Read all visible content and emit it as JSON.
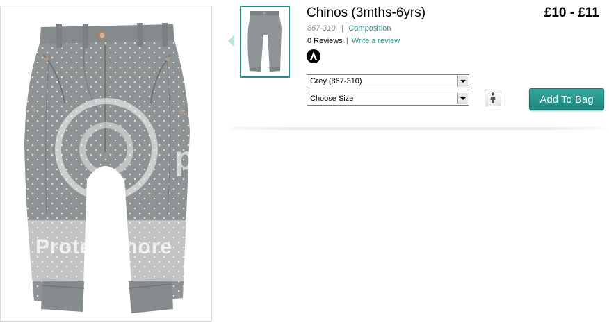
{
  "product": {
    "title": "Chinos (3mths-6yrs)",
    "price": "£10 - £11",
    "code": "867-310",
    "composition_link": "Composition",
    "reviews_count": "0 Reviews",
    "write_review_link": "Write a review",
    "separator": "|"
  },
  "options": {
    "colour_selected": "Grey (867-310)",
    "size_selected": "Choose Size"
  },
  "buttons": {
    "add_to_bag": "Add To Bag"
  },
  "watermark": {
    "text": "Protect more",
    "letter": "p"
  },
  "colors": {
    "accent": "#2a8f87",
    "button": "#289890",
    "chino_grey": "#8e9396"
  },
  "icons": {
    "thumbnail_prev": "chevron-left-icon",
    "size_guide": "person-icon",
    "badge": "a-logo-icon"
  }
}
